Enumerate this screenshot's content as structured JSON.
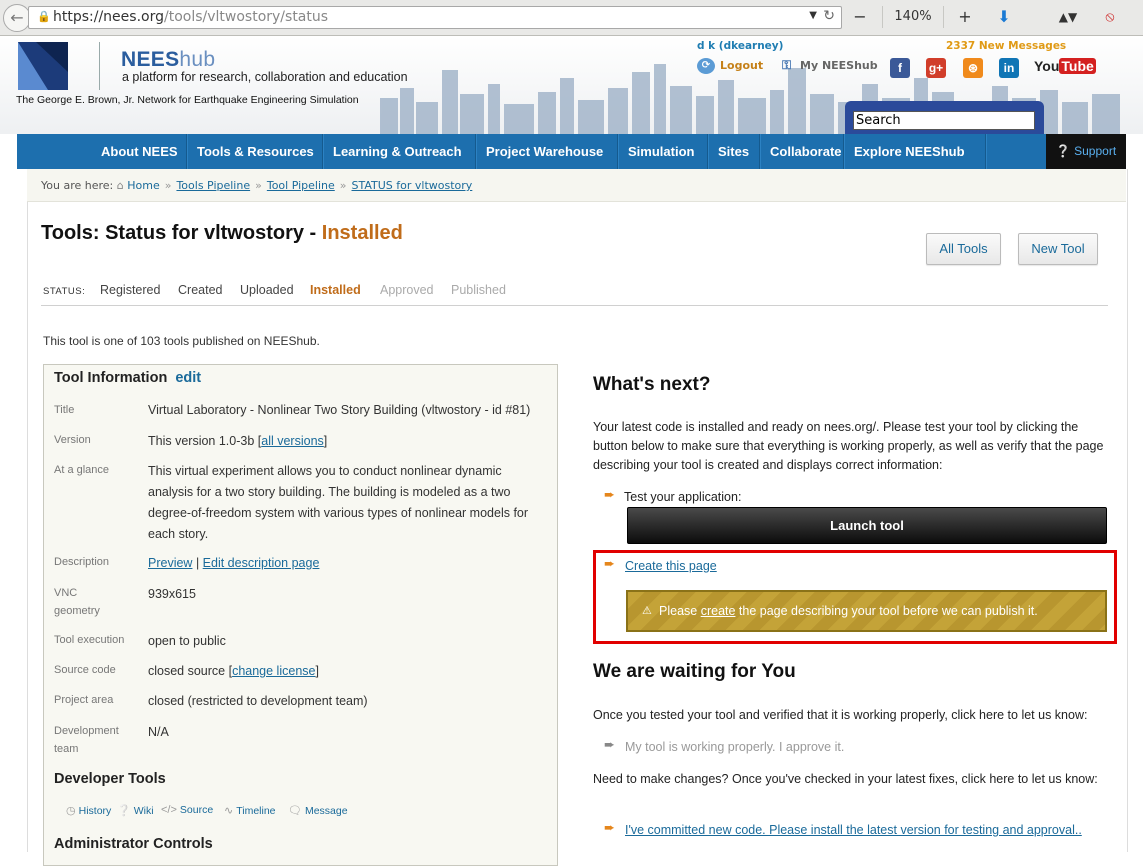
{
  "browser": {
    "url_host": "https://nees.org",
    "url_path": "/tools/vltwostory/status",
    "zoom": "140%"
  },
  "header": {
    "brand_bold": "NEES",
    "brand_light": "hub",
    "tagline": "a platform for research, collaboration and education",
    "network": "The George E. Brown, Jr. Network for Earthquake Engineering Simulation",
    "username": "d k (dkearney)",
    "logout": "Logout",
    "my_nees": "My NEEShub",
    "messages": "2337 New Messages",
    "youtube_you": "You",
    "youtube_tube": "Tube",
    "search_placeholder": "Search"
  },
  "nav": {
    "items": [
      "About NEES",
      "Tools & Resources",
      "Learning & Outreach",
      "Project Warehouse",
      "Simulation",
      "Sites",
      "Collaborate",
      "Explore NEEShub"
    ],
    "support": "Support"
  },
  "breadcrumb": {
    "prefix": "You are here:",
    "items": [
      "Home",
      "Tools Pipeline",
      "Tool Pipeline",
      "STATUS for vltwostory"
    ]
  },
  "page": {
    "title_prefix": "Tools: Status for vltwostory - ",
    "title_status": "Installed",
    "all_tools": "All Tools",
    "new_tool": "New Tool",
    "status_label": "STATUS:",
    "statuses": [
      "Registered",
      "Created",
      "Uploaded",
      "Installed",
      "Approved",
      "Published"
    ],
    "count_text": "This tool is one of 103 tools published on NEEShub."
  },
  "tool_info": {
    "heading": "Tool Information",
    "edit": "edit",
    "title_label": "Title",
    "title_value": "Virtual Laboratory - Nonlinear Two Story Building (vltwostory - id #81)",
    "version_label": "Version",
    "version_value": "This version 1.0-3b [",
    "version_link": "all versions",
    "version_end": "]",
    "glance_label": "At a glance",
    "glance_value": "This virtual experiment allows you to conduct nonlinear dynamic analysis for a two story building. The building is modeled as a two degree-of-freedom system with various types of nonlinear models for each story.",
    "description_label": "Description",
    "preview": "Preview",
    "desc_sep": " | ",
    "edit_description": "Edit description page",
    "vnc_label": "VNC geometry",
    "vnc_value": "939x615",
    "execution_label": "Tool execution",
    "execution_value": "open to public",
    "source_label": "Source code",
    "source_value": "closed source [",
    "source_link": "change license",
    "source_end": "]",
    "project_label": "Project area",
    "project_value": "closed (restricted to development team)",
    "devteam_label": "Development team",
    "devteam_value": "N/A"
  },
  "developer_tools": {
    "heading": "Developer Tools",
    "items": [
      "History",
      "Wiki",
      "Source",
      "Timeline",
      "Message"
    ]
  },
  "admin": {
    "heading": "Administrator Controls"
  },
  "next": {
    "heading": "What's next?",
    "intro": "Your latest code is installed and ready on nees.org/. Please test your tool by clicking the button below to make sure that everything is working properly, as well as verify that the page describing your tool is created and displays correct information:",
    "test_label": "Test your application:",
    "launch": "Launch tool",
    "create_page": "Create this page",
    "warn_pre": "Please ",
    "warn_link": "create",
    "warn_post": " the page describing your tool before we can publish it."
  },
  "waiting": {
    "heading": "We are waiting for You",
    "tested_text": "Once you tested your tool and verified that it is working properly, click here to let us know:",
    "approve": "My tool is working properly. I approve it.",
    "changes_text": "Need to make changes? Once you've checked in your latest fixes, click here to let us know:",
    "committed": "I've committed new code. Please install the latest version for testing and approval.."
  }
}
